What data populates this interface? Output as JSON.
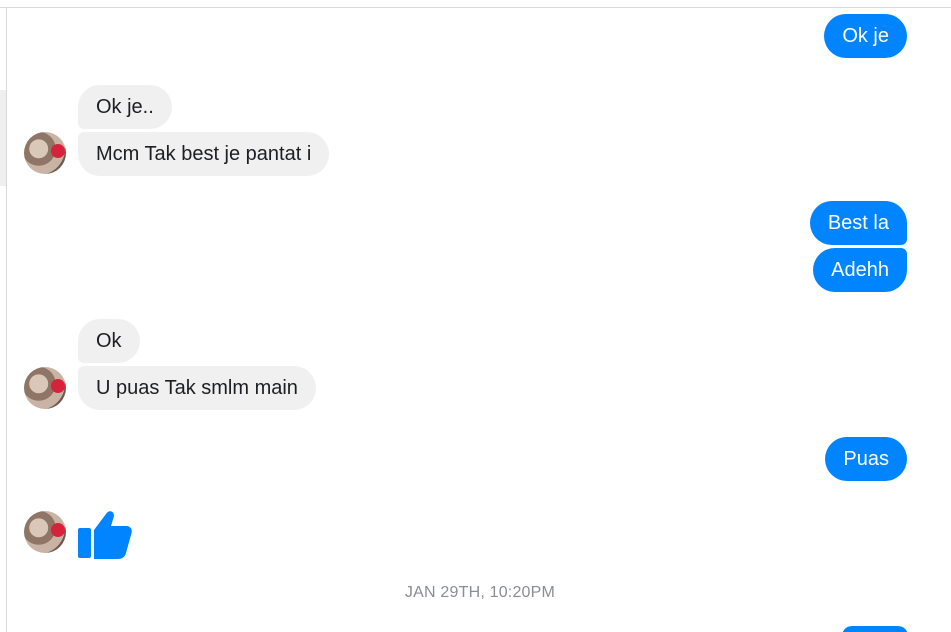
{
  "messages": [
    {
      "id": "m1",
      "side": "out",
      "text": "Ok je"
    },
    {
      "id": "m2",
      "side": "in",
      "text": "Ok je.."
    },
    {
      "id": "m3",
      "side": "in",
      "text": "Mcm Tak best je pantat i"
    },
    {
      "id": "m4",
      "side": "out",
      "text": "Best la"
    },
    {
      "id": "m5",
      "side": "out",
      "text": "Adehh"
    },
    {
      "id": "m6",
      "side": "in",
      "text": "Ok"
    },
    {
      "id": "m7",
      "side": "in",
      "text": "U puas Tak smlm main"
    },
    {
      "id": "m8",
      "side": "out",
      "text": "Puas"
    },
    {
      "id": "m9",
      "side": "in",
      "sticker": "thumbs-up-icon"
    }
  ],
  "timestamp": "JAN 29TH, 10:20PM",
  "colors": {
    "outgoing_bubble": "#0084ff",
    "incoming_bubble": "#f0f0f0",
    "timestamp_text": "#8a8d91"
  }
}
